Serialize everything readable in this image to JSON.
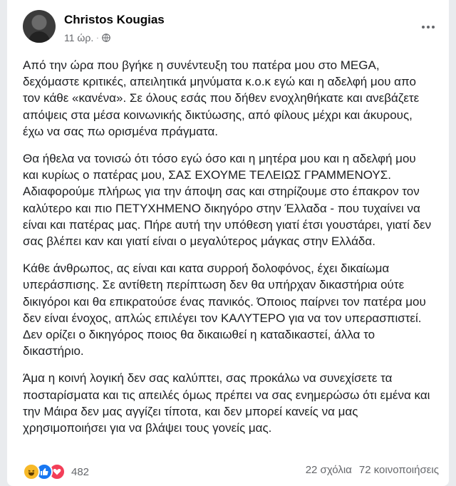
{
  "post": {
    "author": "Christos Kougias",
    "time": "11 ώρ.",
    "paragraphs": [
      "Από την ώρα που βγήκε η συνέντευξη του πατέρα μου στο MEGA, δεχόμαστε κριτικές, απειλητικά μηνύματα κ.ο.κ εγώ και η αδελφή μου απο τον κάθε «κανένα». Σε όλους εσάς που δήθεν ενοχληθήκατε και ανεβάζετε απόψεις στα μέσα κοινωνικής δικτύωσης, από φίλους μέχρι και άκυρους, έχω να σας πω ορισμένα πράγματα.",
      "Θα ήθελα να τονισώ ότι τόσο εγώ όσο και η μητέρα μου και η αδελφή μου και κυρίως ο πατέρας μου, ΣΑΣ ΕΧΟΥΜΕ ΤΕΛΕΙΩΣ ΓΡΑΜΜΕΝΟΥΣ. Αδιαφορούμε πλήρως για την άποψη σας και στηρίζουμε στο έπακρον τον καλύτερο και πιο ΠΕΤΥΧΗΜΕΝΟ δικηγόρο στην Έλλαδα - που τυχαίνει να είναι και πατέρας μας. Πήρε αυτή την υπόθεση γιατί έτσι γουστάρει, γιατί δεν σας βλέπει καν και γιατί είναι ο μεγαλύτερος μάγκας στην Ελλάδα.",
      "Κάθε άνθρωπος, ας είναι και κατα συρροή δολοφόνος, έχει δικαίωμα υπεράσπισης. Σε αντίθετη περίπτωση δεν θα υπήρχαν δικαστήρια ούτε δικιγόροι και θα επικρατούσε ένας πανικός. Όποιος παίρνει τον πατέρα μου δεν είναι ένοχος, απλώς επιλέγει τον ΚΑΛΥΤΕΡΟ για να τον υπερασπιστεί. Δεν ορίζει ο δικηγόρος ποιος θα δικαιωθεί η καταδικαστεί, άλλα το δικαστήριο.",
      "Άμα η κοινή λογική δεν σας καλύπτει, σας προκάλω να συνεχίσετε τα ποσταρίσματα και τις απειλές όμως πρέπει να σας ενημερώσω ότι εμένα και την Μάιρα δεν μας αγγίζει τίποτα, και δεν μπορεί κανείς να μας χρησιμοποιήσει για να βλάψει τους γονείς μας."
    ],
    "reactions": {
      "icons": [
        "haha-icon",
        "like-icon",
        "love-icon"
      ],
      "count": "482"
    },
    "comments": "22 σχόλια",
    "shares": "72 κοινοποιήσεις"
  },
  "colors": {
    "like": "#1877f2",
    "love": "#f33e58",
    "haha": "#f7b928",
    "secondary_text": "#65676b"
  }
}
